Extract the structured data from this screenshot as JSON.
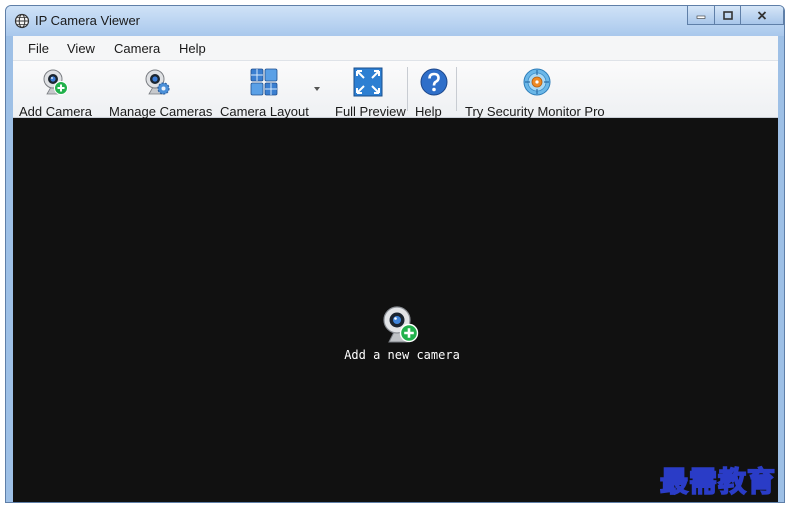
{
  "window": {
    "title": "IP Camera Viewer"
  },
  "menu": {
    "items": [
      "File",
      "View",
      "Camera",
      "Help"
    ]
  },
  "toolbar": {
    "add_camera": "Add Camera",
    "manage_cameras": "Manage Cameras",
    "camera_layout": "Camera Layout",
    "full_preview": "Full Preview",
    "help": "Help",
    "try_pro": "Try Security Monitor Pro"
  },
  "viewport": {
    "add_camera_text": "Add a new camera"
  },
  "watermark": {
    "text": "最需教育"
  },
  "colors": {
    "viewport_bg": "#111111",
    "accent_green": "#22b14c",
    "help_blue": "#2f6fc9"
  },
  "icons": [
    "globe-icon",
    "camera-add-icon",
    "camera-gear-icon",
    "layout-grid-icon",
    "fullscreen-icon",
    "help-icon",
    "security-monitor-icon"
  ]
}
